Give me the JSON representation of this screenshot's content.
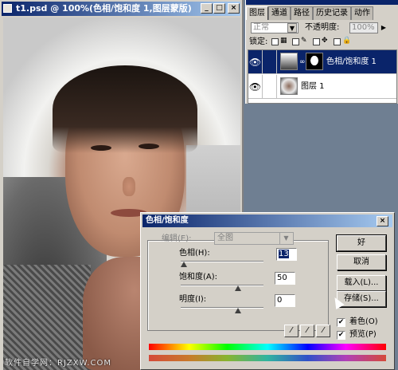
{
  "document": {
    "title": "t1.psd @ 100%(色相/饱和度 1,图层蒙版)",
    "controls": [
      "_",
      "□",
      "×"
    ]
  },
  "watermark": "软件自学网：RJZXW.COM",
  "layers_palette": {
    "tabs": [
      "图层",
      "通道",
      "路径",
      "历史记录",
      "动作"
    ],
    "active_tab": "图层",
    "blend_mode": "正常",
    "opacity_label": "不透明度:",
    "opacity_value": "100%",
    "lock_label": "锁定:",
    "layers": [
      {
        "name": "色相/饱和度 1",
        "selected": true
      },
      {
        "name": "图层 1",
        "selected": false
      }
    ]
  },
  "dialog": {
    "title": "色相/饱和度",
    "edit_label": "编辑(E):",
    "edit_value": "全图",
    "hue": {
      "label": "色相(H):",
      "value": "13"
    },
    "saturation": {
      "label": "饱和度(A):",
      "value": "50"
    },
    "lightness": {
      "label": "明度(I):",
      "value": "0"
    },
    "buttons": {
      "ok": "好",
      "cancel": "取消",
      "load": "载入(L)...",
      "save": "存储(S)..."
    },
    "colorize": {
      "label": "着色(O)",
      "checked": true
    },
    "preview": {
      "label": "预览(P)",
      "checked": true
    }
  }
}
